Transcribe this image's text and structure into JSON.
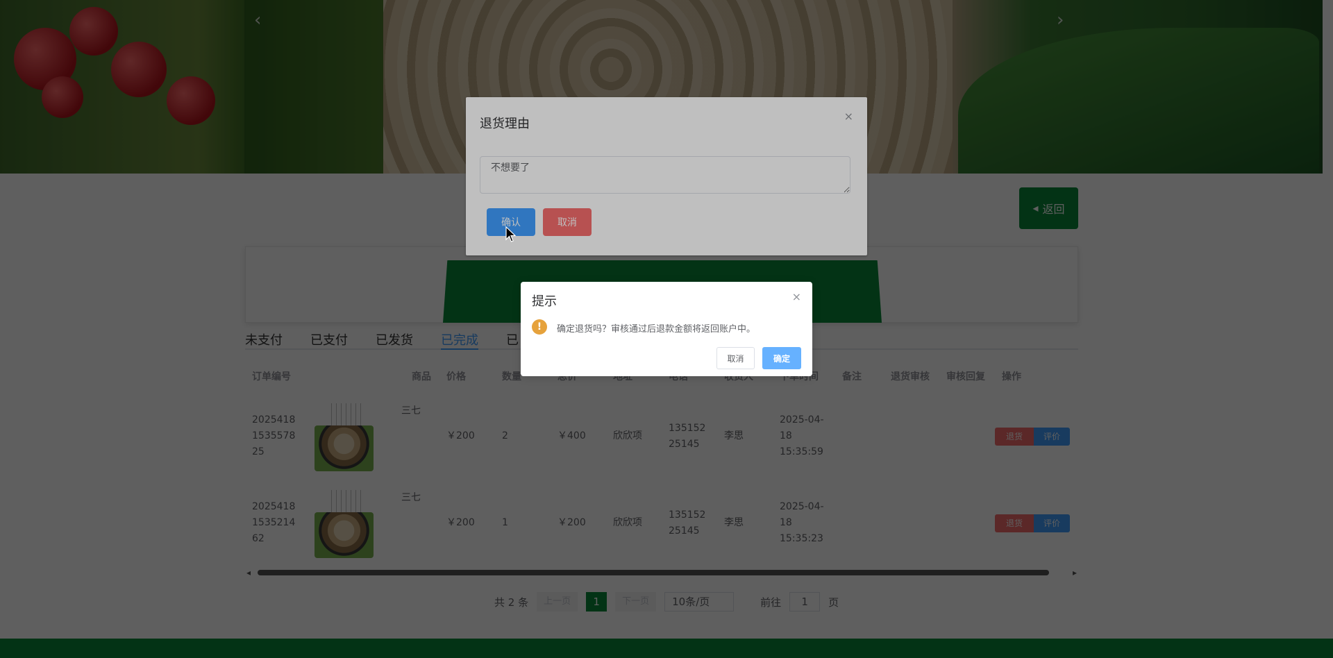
{
  "banner": {
    "prev_icon": "chevron-left-icon",
    "next_icon": "chevron-right-icon",
    "prev_glyph": "‹",
    "next_glyph": "›"
  },
  "back_button": {
    "label": "返回",
    "icon": "triangle-left-icon",
    "glyph": "◂"
  },
  "tabs": [
    {
      "label": "未支付"
    },
    {
      "label": "已支付"
    },
    {
      "label": "已发货"
    },
    {
      "label": "已完成"
    },
    {
      "label": "已"
    }
  ],
  "active_tab": 3,
  "table": {
    "headers": [
      "订单编号",
      "商品",
      "价格",
      "数量",
      "总价",
      "地址",
      "电话",
      "收货人",
      "下单时间",
      "备注",
      "退货审核",
      "审核回复",
      "操作"
    ],
    "rows": [
      {
        "order_id": "2025418153557825",
        "product": "三七",
        "price": "￥200",
        "qty": "2",
        "total": "￥400",
        "address": "欣欣项",
        "phone": "13515225145",
        "receiver": "李思",
        "time": "2025-04-18 15:35:59",
        "note": "",
        "audit": "",
        "reply": "",
        "return_label": "退货",
        "review_label": "评价"
      },
      {
        "order_id": "2025418153521462",
        "product": "三七",
        "price": "￥200",
        "qty": "1",
        "total": "￥200",
        "address": "欣欣项",
        "phone": "13515225145",
        "receiver": "李思",
        "time": "2025-04-18 15:35:23",
        "note": "",
        "audit": "",
        "reply": "",
        "return_label": "退货",
        "review_label": "评价"
      }
    ]
  },
  "pager": {
    "total": "共 2 条",
    "prev": "上一页",
    "current": "1",
    "next": "下一页",
    "size": "10条/页",
    "goto": "前往",
    "page_value": "1",
    "page_suffix": "页"
  },
  "return_dialog": {
    "title": "退货理由",
    "reason": "不想要了",
    "confirm": "确认",
    "cancel": "取消",
    "close_glyph": "×"
  },
  "confirm_box": {
    "title": "提示",
    "message": "确定退货吗？审核通过后退款金额将返回账户中。",
    "cancel": "取消",
    "ok": "确定",
    "close_glyph": "×",
    "warn_glyph": "!"
  },
  "colors": {
    "brand_green": "#0b8a3a",
    "primary": "#409eff",
    "danger": "#f56c6c",
    "warning": "#e6a23c"
  }
}
